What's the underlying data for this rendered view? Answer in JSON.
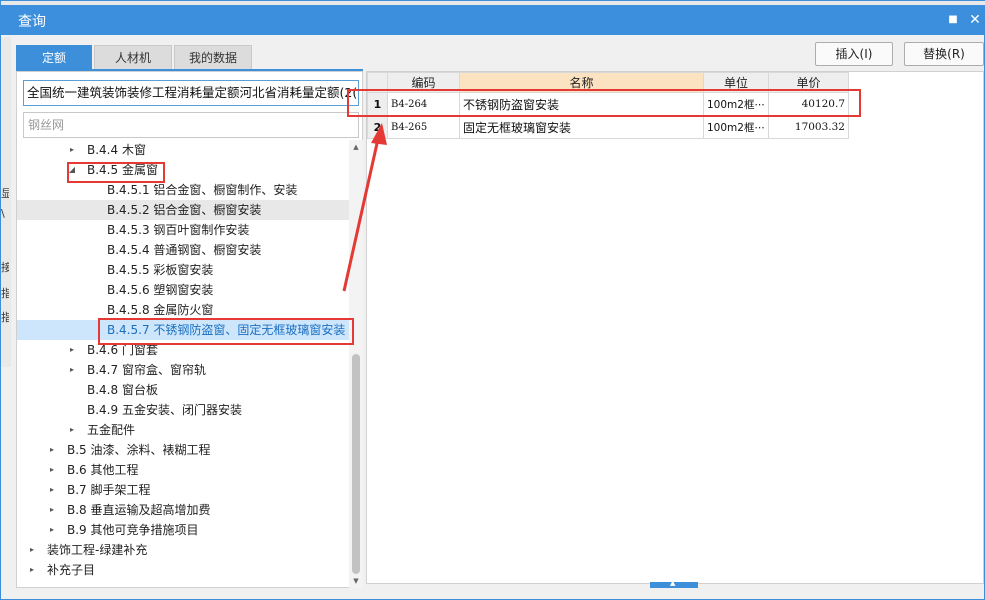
{
  "window": {
    "title": "查询",
    "restore_glyph": "■",
    "close_glyph": "✕"
  },
  "tabs": [
    {
      "label": "定额",
      "active": true
    },
    {
      "label": "人材机",
      "active": false
    },
    {
      "label": "我的数据",
      "active": false
    }
  ],
  "actions": {
    "insert_label": "插入(I)",
    "replace_label": "替换(R)"
  },
  "db_selector": {
    "value": "全国统一建筑装饰装修工程消耗量定额河北省消耗量定额(2("
  },
  "search": {
    "value": "钢丝网"
  },
  "tree": [
    {
      "label": "B.4.4 木窗",
      "arrow": "▸"
    },
    {
      "label": "B.4.5 金属窗",
      "arrow": "◢"
    },
    {
      "label": "B.4.5.1 铝合金窗、橱窗制作、安装",
      "arrow": ""
    },
    {
      "label": "B.4.5.2 铝合金窗、橱窗安装",
      "arrow": ""
    },
    {
      "label": "B.4.5.3 钢百叶窗制作安装",
      "arrow": ""
    },
    {
      "label": "B.4.5.4 普通钢窗、橱窗安装",
      "arrow": ""
    },
    {
      "label": "B.4.5.5 彩板窗安装",
      "arrow": ""
    },
    {
      "label": "B.4.5.6 塑钢窗安装",
      "arrow": ""
    },
    {
      "label": "B.4.5.8 金属防火窗",
      "arrow": ""
    },
    {
      "label": "B.4.5.7 不锈钢防盗窗、固定无框玻璃窗安装",
      "arrow": ""
    },
    {
      "label": "B.4.6 门窗套",
      "arrow": "▸"
    },
    {
      "label": "B.4.7 窗帘盒、窗帘轨",
      "arrow": "▸"
    },
    {
      "label": "B.4.8 窗台板",
      "arrow": ""
    },
    {
      "label": "B.4.9 五金安装、闭门器安装",
      "arrow": ""
    },
    {
      "label": "五金配件",
      "arrow": "▸"
    },
    {
      "label": "B.5 油漆、涂料、裱糊工程",
      "arrow": "▸"
    },
    {
      "label": "B.6 其他工程",
      "arrow": "▸"
    },
    {
      "label": "B.7 脚手架工程",
      "arrow": "▸"
    },
    {
      "label": "B.8 垂直运输及超高增加费",
      "arrow": "▸"
    },
    {
      "label": "B.9 其他可竞争措施项目",
      "arrow": "▸"
    },
    {
      "label": "装饰工程-绿建补充",
      "arrow": "▸"
    },
    {
      "label": "补充子目",
      "arrow": "▸"
    }
  ],
  "scrollbar": {
    "up_glyph": "▲",
    "down_glyph": "▼"
  },
  "grid": {
    "headers": [
      "编码",
      "名称",
      "单位",
      "单价"
    ],
    "rows": [
      {
        "index": "1",
        "code": "B4-264",
        "name": "不锈钢防盗窗安装",
        "unit": "100m2框⋯",
        "price": "40120.7"
      },
      {
        "index": "2",
        "code": "B4-265",
        "name": "固定无框玻璃窗安装",
        "unit": "100m2框⋯",
        "price": "17003.32"
      }
    ]
  },
  "bottom_grip": {
    "glyph": "▲"
  },
  "background_fragments": [
    "显",
    "\\",
    "接",
    "指",
    "指"
  ],
  "colors": {
    "accent": "#3b8fdc",
    "highlight_red": "#e53935",
    "selected_row": "#cde6fb",
    "name_header": "#fbe3c2"
  }
}
